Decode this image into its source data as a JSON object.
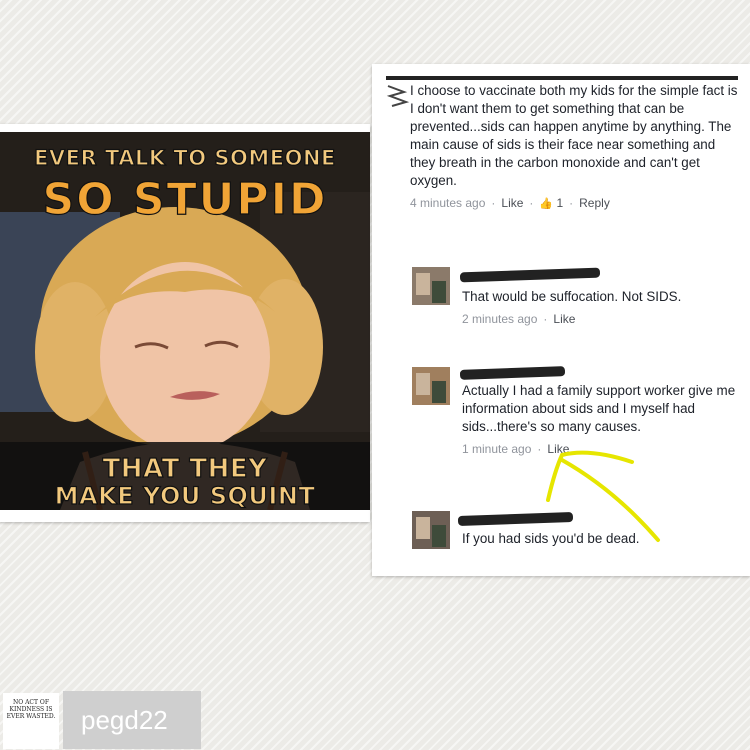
{
  "meme": {
    "line1": "EVER TALK TO SOMEONE",
    "line2": "SO STUPID",
    "line3": "THAT THEY",
    "line4": "MAKE YOU SQUINT"
  },
  "comments": [
    {
      "text": "I choose to vaccinate both my kids for the simple fact is I don't want them to get something that can be prevented...sids can happen anytime by anything. The main cause of sids is their face near something and they breath in the carbon monoxide and can't get oxygen.",
      "time": "4 minutes ago",
      "like_label": "Like",
      "like_count": "1",
      "reply_label": "Reply"
    },
    {
      "text": "That would be suffocation. Not SIDS.",
      "time": "2 minutes ago",
      "like_label": "Like"
    },
    {
      "text": "Actually I had a family support worker give me information about sids and I myself had sids...there's so many causes.",
      "time": "1 minute ago",
      "like_label": "Like"
    },
    {
      "text": "If you had sids you'd be dead."
    }
  ],
  "credit": {
    "username": "pegd22",
    "logo_text": "NO ACT OF KINDNESS IS EVER WASTED."
  },
  "colors": {
    "highlight": "#e6e600",
    "meta_gray": "#90949c"
  }
}
